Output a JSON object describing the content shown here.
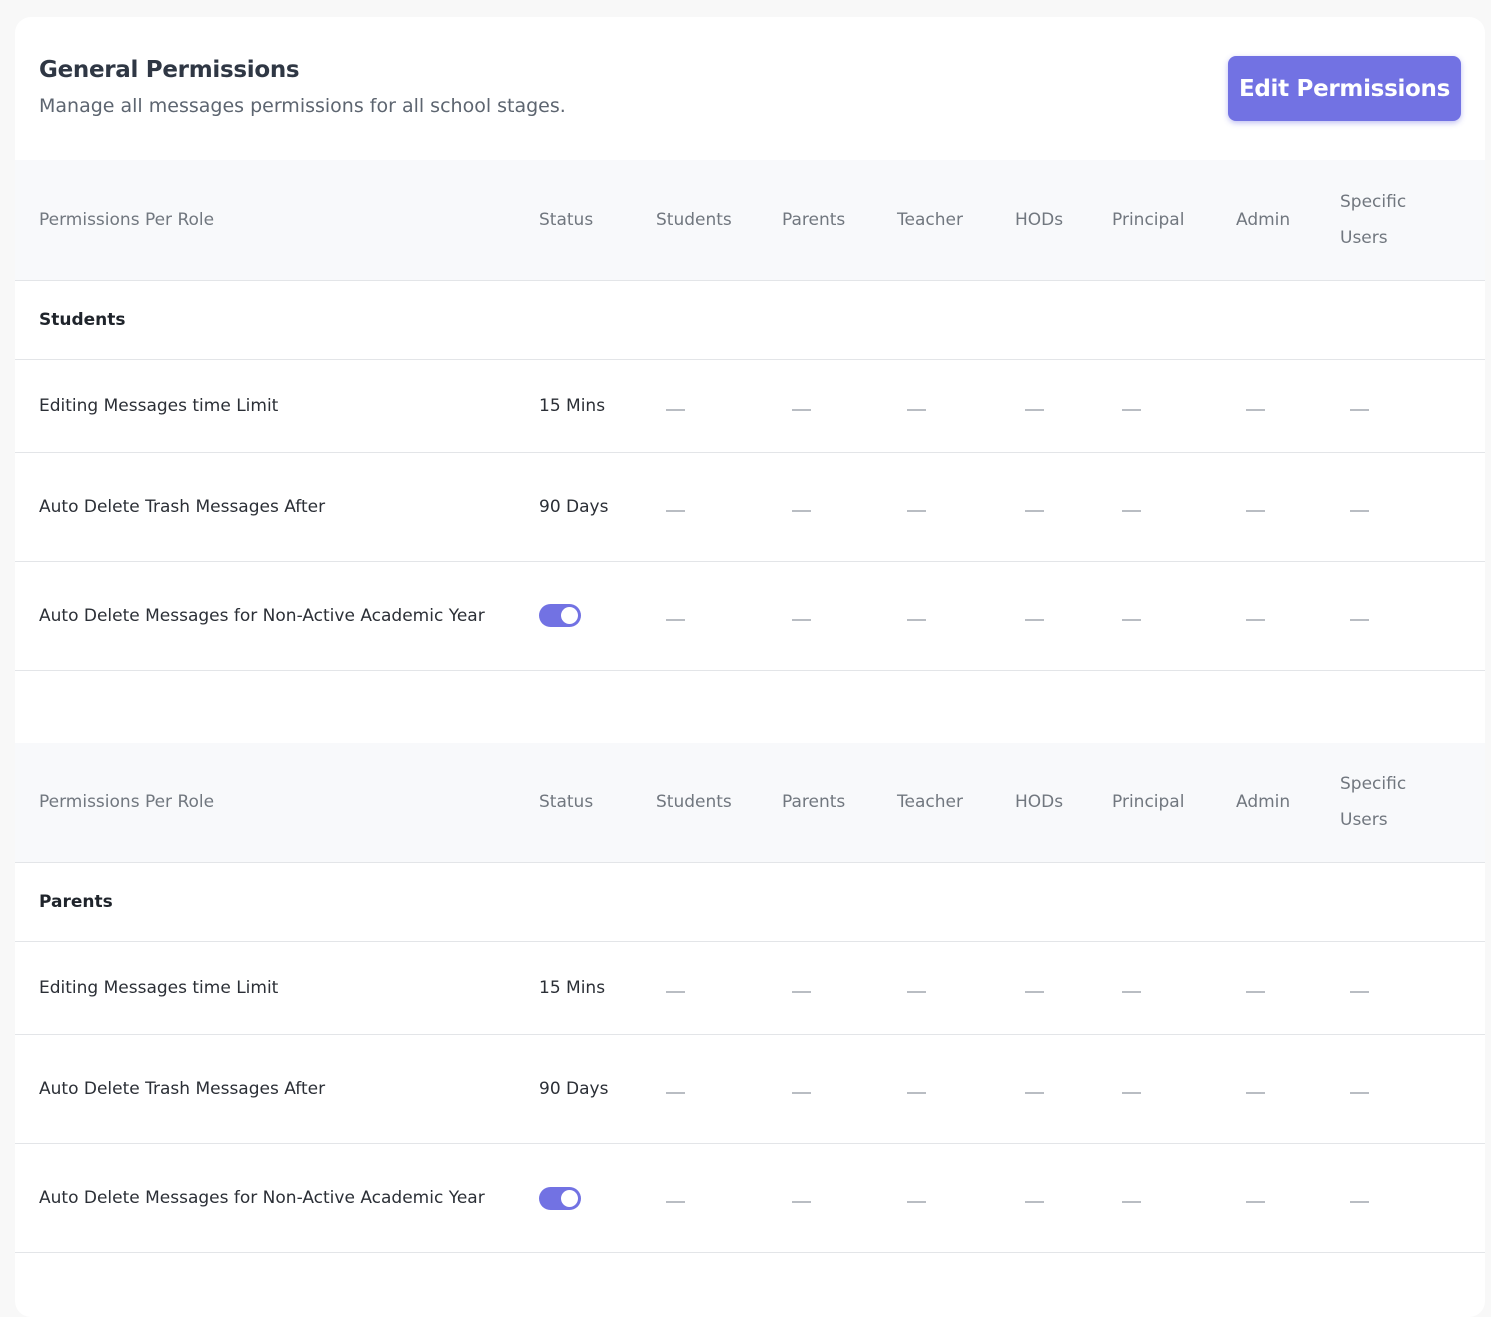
{
  "header": {
    "title": "General Permissions",
    "subtitle": "Manage all messages permissions for all school stages.",
    "edit_button_label": "Edit Permissions"
  },
  "columns": {
    "role": "Permissions Per Role",
    "status": "Status",
    "students": "Students",
    "parents": "Parents",
    "teacher": "Teacher",
    "hods": "HODs",
    "principal": "Principal",
    "admin": "Admin",
    "specific_users_line1": "Specific",
    "specific_users_line2": "Users"
  },
  "sections": [
    {
      "group": "Students",
      "rows": [
        {
          "label": "Editing Messages time Limit",
          "status": "15 Mins"
        },
        {
          "label": "Auto Delete Trash Messages After",
          "status": "90 Days"
        },
        {
          "label": "Auto Delete Messages for Non-Active Academic Year",
          "toggle_on": true
        }
      ]
    },
    {
      "group": "Parents",
      "rows": [
        {
          "label": "Editing Messages time Limit",
          "status": "15 Mins"
        },
        {
          "label": "Auto Delete Trash Messages After",
          "status": "90 Days"
        },
        {
          "label": "Auto Delete Messages for Non-Active Academic Year",
          "toggle_on": true
        }
      ]
    }
  ],
  "accent_color": "#7272e3"
}
